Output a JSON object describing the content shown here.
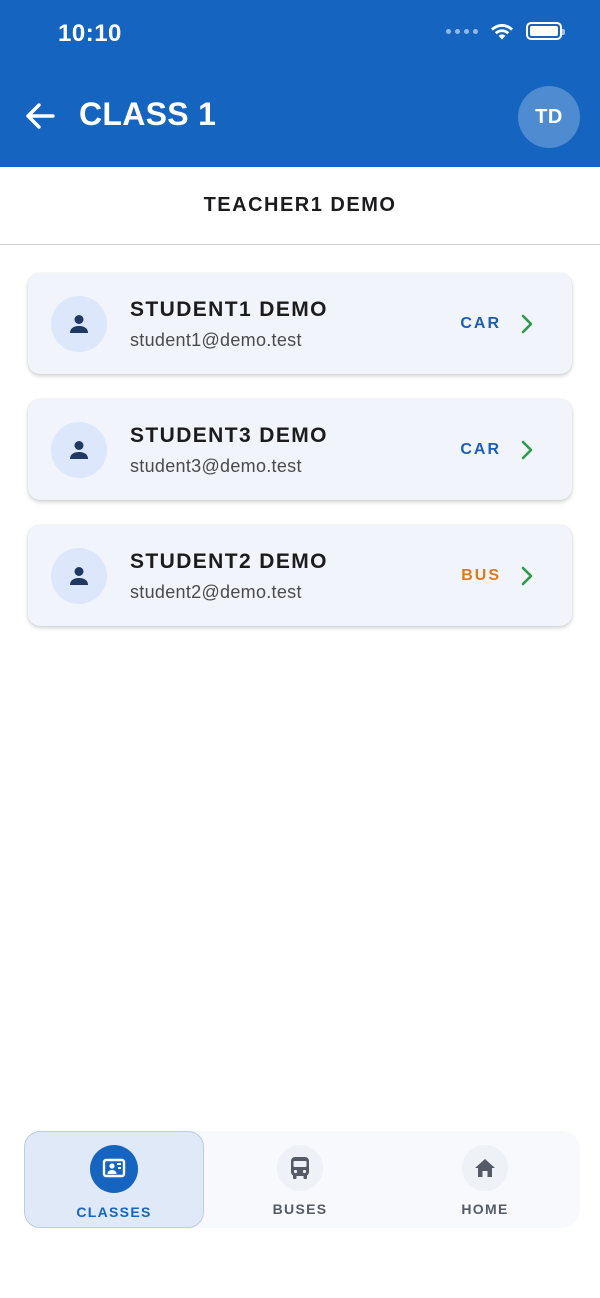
{
  "status_bar": {
    "time": "10:10"
  },
  "header": {
    "title": "CLASS 1",
    "avatar_initials": "TD"
  },
  "subheader": {
    "teacher_name": "TEACHER1 DEMO"
  },
  "students": [
    {
      "name": "STUDENT1 DEMO",
      "email": "student1@demo.test",
      "transport": "CAR"
    },
    {
      "name": "STUDENT3 DEMO",
      "email": "student3@demo.test",
      "transport": "CAR"
    },
    {
      "name": "STUDENT2 DEMO",
      "email": "student2@demo.test",
      "transport": "BUS"
    }
  ],
  "colors": {
    "primary": "#1565c0",
    "car": "#1a5fb4",
    "bus": "#e07b1a",
    "chevron": "#2e9a4a"
  },
  "bottom_nav": {
    "items": [
      {
        "label": "CLASSES",
        "icon": "classes-icon",
        "active": true
      },
      {
        "label": "BUSES",
        "icon": "bus-icon",
        "active": false
      },
      {
        "label": "HOME",
        "icon": "home-icon",
        "active": false
      }
    ]
  }
}
